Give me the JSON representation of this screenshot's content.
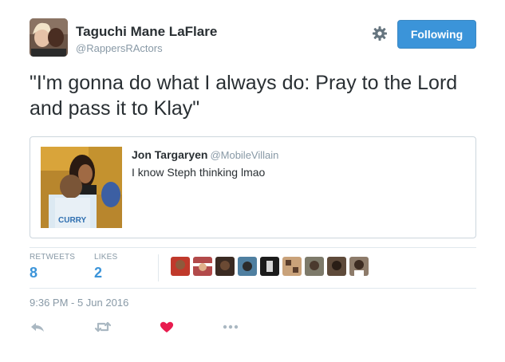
{
  "author": {
    "name": "Taguchi Mane LaFlare",
    "handle": "@RappersRActors"
  },
  "follow_button": {
    "label": "Following"
  },
  "icons": {
    "settings": "gear-icon",
    "reply": "reply-icon",
    "retweet": "retweet-icon",
    "like": "heart-icon",
    "more": "more-icon"
  },
  "tweet": {
    "text": "\"I'm gonna do what I always do: Pray to the Lord and pass it to Klay\""
  },
  "quoted_tweet": {
    "name": "Jon Targaryen",
    "handle": "@MobileVillain",
    "text": "I know Steph thinking lmao"
  },
  "stats": {
    "retweets_label": "RETWEETS",
    "retweets_count": "8",
    "likes_label": "LIKES",
    "likes_count": "2"
  },
  "timestamp": "9:36 PM - 5 Jun 2016",
  "colors": {
    "accent": "#3b94d9",
    "like": "#e81c4f",
    "muted": "#8899a6"
  }
}
